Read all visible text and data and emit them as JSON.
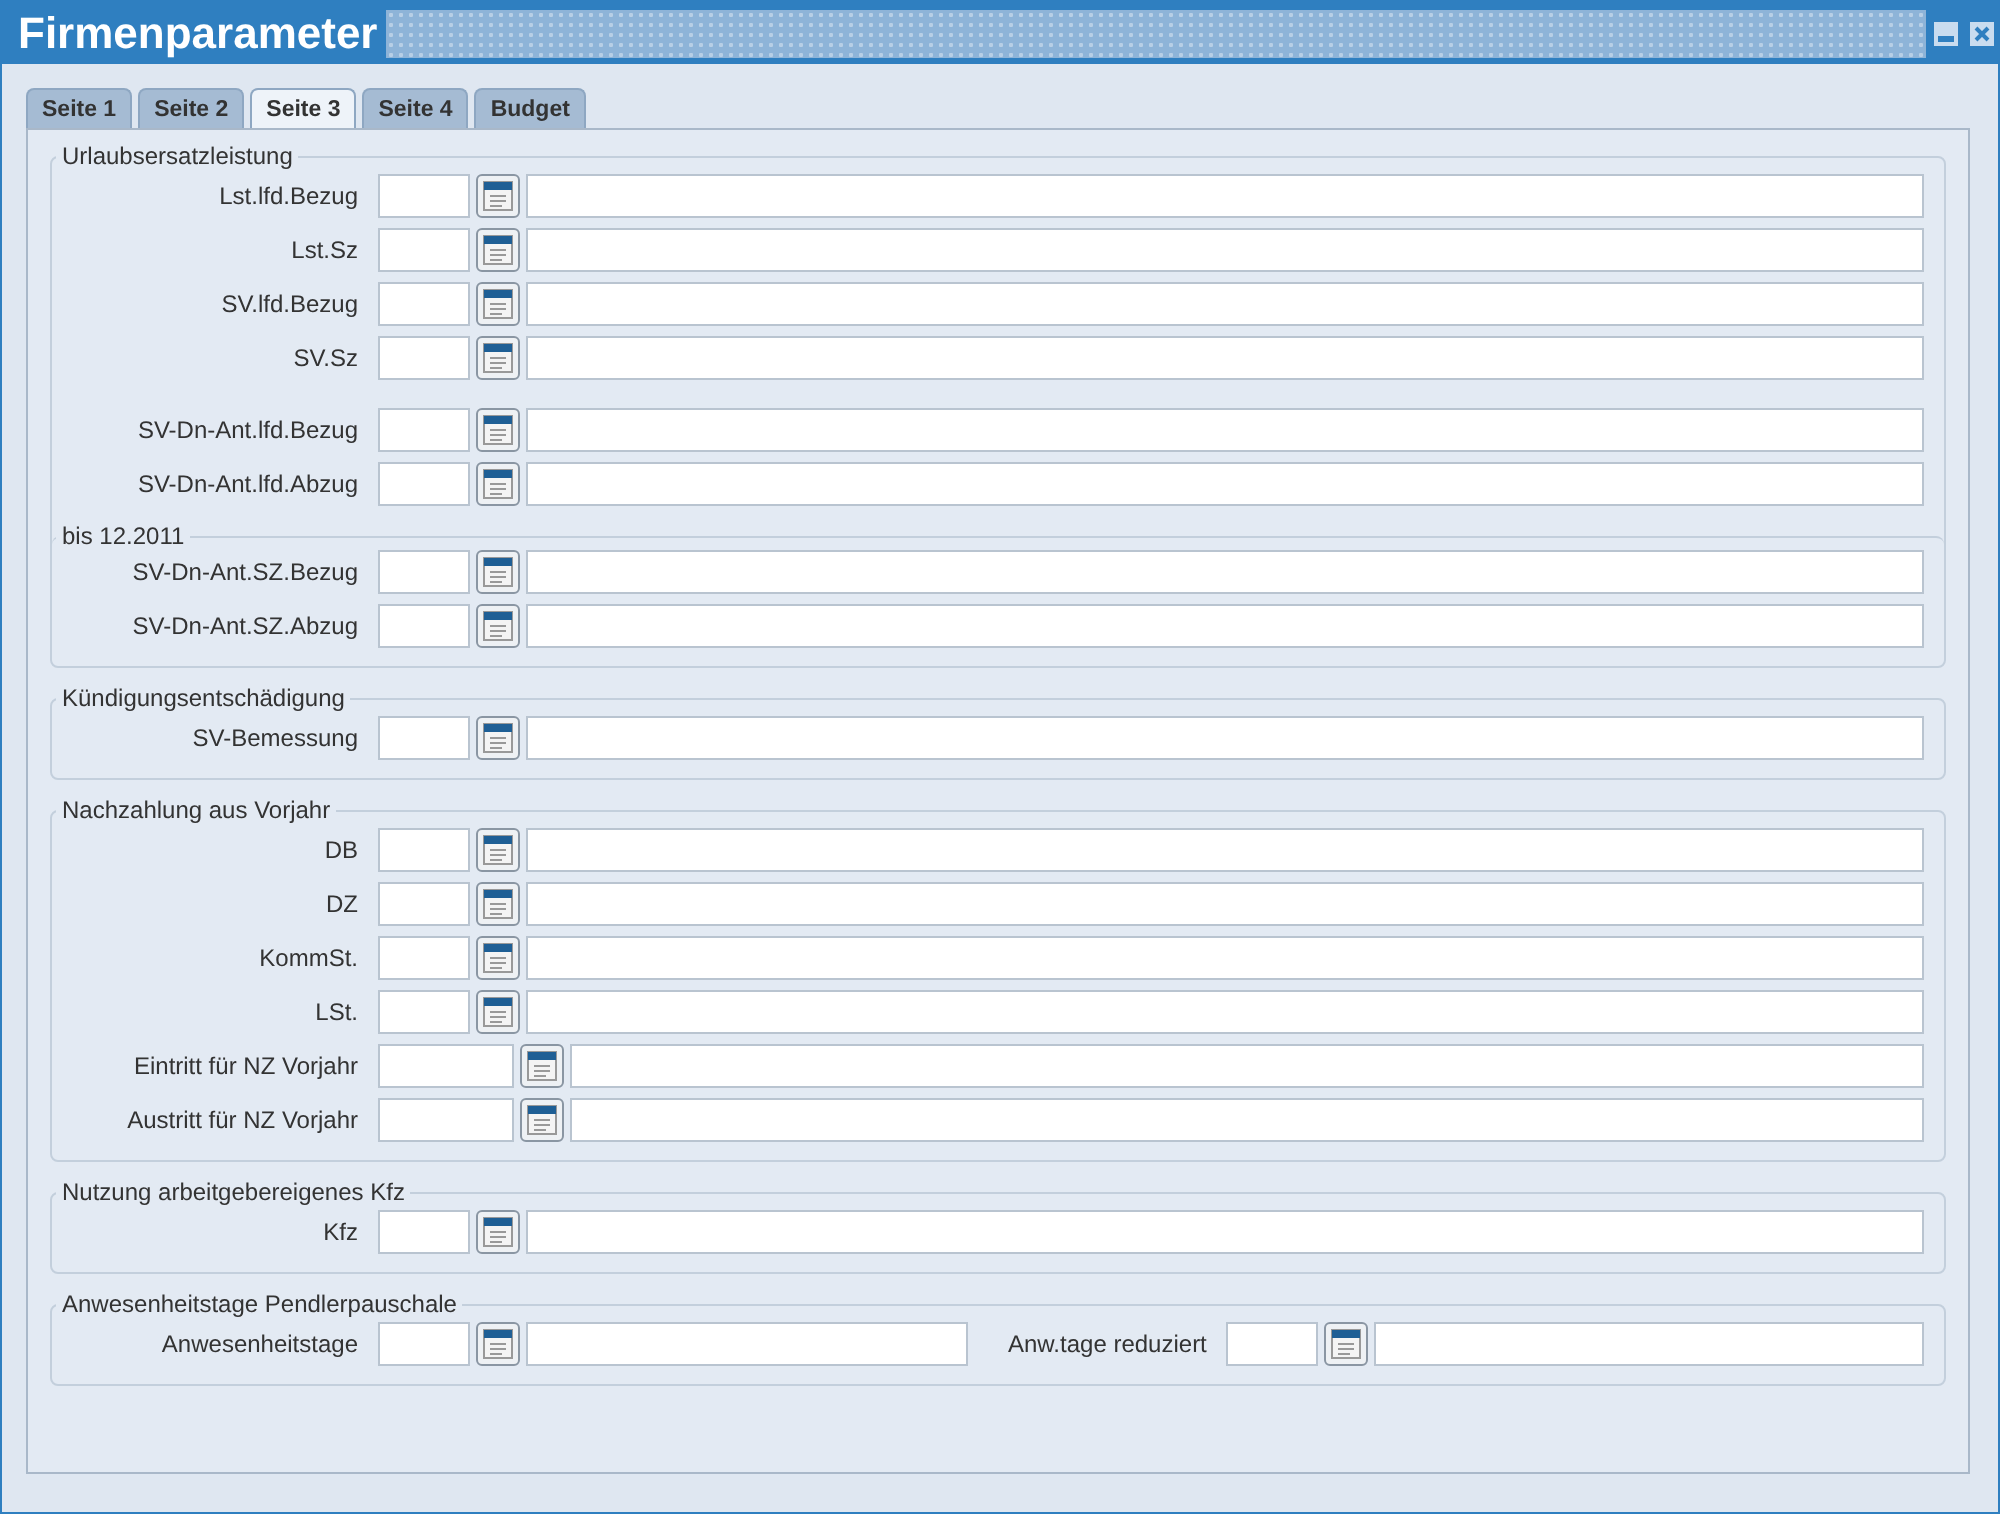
{
  "window": {
    "title": "Firmenparameter"
  },
  "tabs": [
    {
      "label": "Seite 1",
      "selected": false
    },
    {
      "label": "Seite 2",
      "selected": false
    },
    {
      "label": "Seite 3",
      "selected": true
    },
    {
      "label": "Seite 4",
      "selected": false
    },
    {
      "label": "Budget",
      "selected": false
    }
  ],
  "groups": [
    {
      "legend": "Urlaubsersatzleistung",
      "blocks": [
        {
          "rows": [
            {
              "fields": [
                {
                  "label": "Lst.lfd.Bezug",
                  "kind": "short"
                }
              ]
            },
            {
              "fields": [
                {
                  "label": "Lst.Sz",
                  "kind": "short"
                }
              ]
            },
            {
              "fields": [
                {
                  "label": "SV.lfd.Bezug",
                  "kind": "short"
                }
              ]
            },
            {
              "fields": [
                {
                  "label": "SV.Sz",
                  "kind": "short"
                }
              ]
            }
          ]
        },
        {
          "rows": [
            {
              "fields": [
                {
                  "label": "SV-Dn-Ant.lfd.Bezug",
                  "kind": "short"
                }
              ]
            },
            {
              "fields": [
                {
                  "label": "SV-Dn-Ant.lfd.Abzug",
                  "kind": "short"
                }
              ]
            }
          ]
        },
        {
          "legend": "bis 12.2011",
          "rows": [
            {
              "fields": [
                {
                  "label": "SV-Dn-Ant.SZ.Bezug",
                  "kind": "short"
                }
              ]
            },
            {
              "fields": [
                {
                  "label": "SV-Dn-Ant.SZ.Abzug",
                  "kind": "short"
                }
              ]
            }
          ]
        }
      ]
    },
    {
      "legend": "Kündigungsentschädigung",
      "blocks": [
        {
          "rows": [
            {
              "fields": [
                {
                  "label": "SV-Bemessung",
                  "kind": "short"
                }
              ]
            }
          ]
        }
      ]
    },
    {
      "legend": "Nachzahlung aus Vorjahr",
      "blocks": [
        {
          "rows": [
            {
              "fields": [
                {
                  "label": "DB",
                  "kind": "short"
                }
              ]
            },
            {
              "fields": [
                {
                  "label": "DZ",
                  "kind": "short"
                }
              ]
            },
            {
              "fields": [
                {
                  "label": "KommSt.",
                  "kind": "short"
                }
              ]
            },
            {
              "fields": [
                {
                  "label": "LSt.",
                  "kind": "short"
                }
              ]
            },
            {
              "fields": [
                {
                  "label": "Eintritt für NZ Vorjahr",
                  "kind": "long"
                }
              ]
            },
            {
              "fields": [
                {
                  "label": "Austritt für NZ Vorjahr",
                  "kind": "long"
                }
              ]
            }
          ]
        }
      ]
    },
    {
      "legend": "Nutzung arbeitgebereigenes Kfz",
      "blocks": [
        {
          "rows": [
            {
              "fields": [
                {
                  "label": "Kfz",
                  "kind": "short"
                }
              ]
            }
          ]
        }
      ]
    },
    {
      "legend": "Anwesenheitstage Pendlerpauschale",
      "blocks": [
        {
          "rows": [
            {
              "fields": [
                {
                  "label": "Anwesenheitstage",
                  "kind": "short"
                },
                {
                  "label": "Anw.tage reduziert",
                  "kind": "short"
                }
              ]
            }
          ]
        }
      ]
    }
  ]
}
